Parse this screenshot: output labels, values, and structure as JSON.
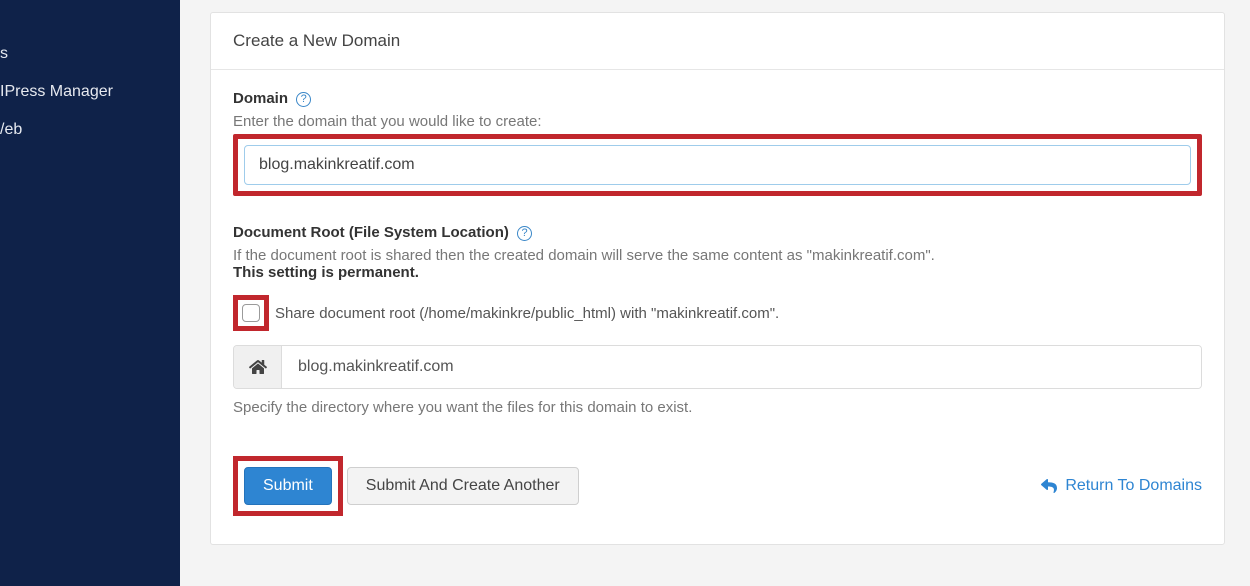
{
  "sidebar": {
    "items": [
      {
        "label": "IPress Manager"
      },
      {
        "label": "/eb"
      }
    ],
    "partial_top": "s"
  },
  "panel": {
    "title": "Create a New Domain"
  },
  "domain": {
    "label": "Domain",
    "hint": "Enter the domain that you would like to create:",
    "value": "blog.makinkreatif.com"
  },
  "docroot": {
    "label": "Document Root (File System Location)",
    "hint_prefix": "If the document root is shared then the created domain will serve the same content as \"",
    "hint_site": "makinkreatif.com",
    "hint_suffix": "\".",
    "permanent_note": "This setting is permanent.",
    "share_prefix": "Share document root (",
    "share_path": "/home/makinkre/public_html",
    "share_mid": ") with \"",
    "share_site": "makinkreatif.com",
    "share_suffix": "\".",
    "dir_value": "blog.makinkreatif.com",
    "dir_hint": "Specify the directory where you want the files for this domain to exist."
  },
  "actions": {
    "submit": "Submit",
    "submit_another": "Submit And Create Another",
    "return": "Return To Domains"
  }
}
